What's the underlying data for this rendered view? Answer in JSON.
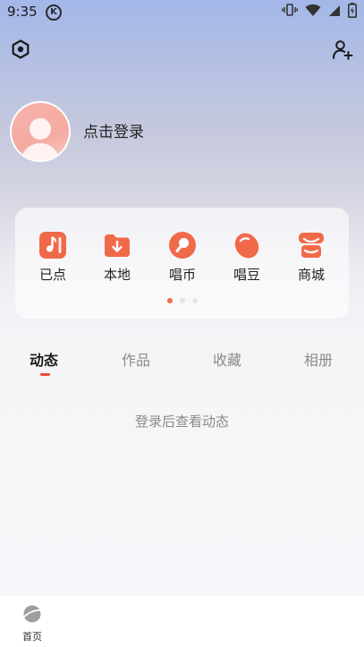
{
  "status_bar": {
    "time": "9:35",
    "k_badge": "K"
  },
  "profile": {
    "login_text": "点击登录"
  },
  "quick_actions": [
    {
      "label": "已点",
      "icon": "music-note-icon"
    },
    {
      "label": "本地",
      "icon": "download-folder-icon"
    },
    {
      "label": "唱币",
      "icon": "coin-icon"
    },
    {
      "label": "唱豆",
      "icon": "bean-icon"
    },
    {
      "label": "商城",
      "icon": "shop-icon"
    }
  ],
  "pager": {
    "pages": 3,
    "active": 1
  },
  "tabs": [
    {
      "label": "动态",
      "active": true
    },
    {
      "label": "作品",
      "active": false
    },
    {
      "label": "收藏",
      "active": false
    },
    {
      "label": "相册",
      "active": false
    }
  ],
  "empty_state": {
    "text": "登录后查看动态"
  },
  "bottom_nav": {
    "home_label": "首页"
  },
  "colors": {
    "accent": "#f06a4a",
    "tab_indicator": "#ee4a37",
    "avatar": "#f5aea5"
  }
}
